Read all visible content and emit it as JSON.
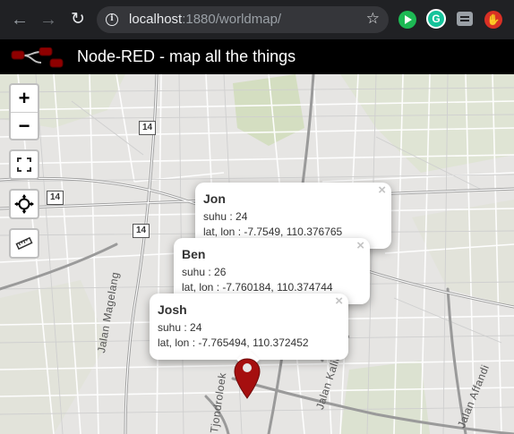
{
  "browser": {
    "url_host": "localhost",
    "url_path": ":1880/worldmap/",
    "back_icon": "←",
    "forward_icon": "→",
    "reload_icon": "↻",
    "star_icon": "☆",
    "grammarly_letter": "G",
    "ext_hand_glyph": "✋"
  },
  "header": {
    "title": "Node-RED - map all the things"
  },
  "map": {
    "zoom_in": "+",
    "zoom_out": "−",
    "road_shields": [
      "14",
      "14",
      "14"
    ],
    "streets": [
      "Jalan Magelang",
      "Tjondroloek",
      "Jalan Kaliurang",
      "Jalan Affandi"
    ],
    "popups": [
      {
        "name": "Jon",
        "suhu": "suhu : 24",
        "coords": "lat, lon : -7.7549, 110.376765",
        "close": "×"
      },
      {
        "name": "Ben",
        "suhu": "suhu : 26",
        "coords": "lat, lon : -7.760184, 110.374744",
        "close": "×"
      },
      {
        "name": "Josh",
        "suhu": "suhu : 24",
        "coords": "lat, lon : -7.765494, 110.372452",
        "close": "×"
      }
    ],
    "marker_color": "#a50f0f"
  }
}
